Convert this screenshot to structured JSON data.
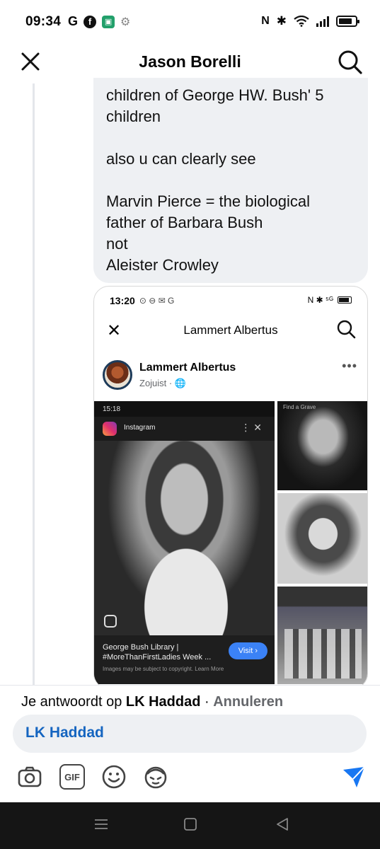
{
  "status_bar": {
    "time": "09:34",
    "g_icon": "G",
    "fb_icon": "f",
    "right_icons": [
      "nfc-icon",
      "bluetooth-icon",
      "wifi-icon",
      "signal-icon",
      "battery-icon"
    ],
    "nfc_label": "N",
    "bt_label": "✱"
  },
  "header": {
    "title": "Jason Borelli"
  },
  "message": {
    "lines": [
      "children of George HW. Bush' 5",
      "children",
      "",
      "also u can clearly see",
      "",
      "Marvin Pierce = the biological",
      "father of Barbara Bush",
      "not",
      "Aleister Crowley"
    ]
  },
  "embedded": {
    "time": "13:20",
    "status_glyphs": "⊙ ⊖ ✉ G",
    "right_glyphs": "N ✱ ⁵ᴳ",
    "title": "Lammert Albertus",
    "post": {
      "author": "Lammert Albertus",
      "meta": "Zojuist · 🌐",
      "dots": "•••"
    },
    "instagram": {
      "inner_time": "15:18",
      "app_name": "Instagram",
      "caption_line1": "George Bush Library |",
      "caption_line2": "#MoreThanFirstLadies Week ...",
      "copyright": "Images may be subject to copyright. Learn More",
      "visit": "Visit ›",
      "controls": "⋮  ✕"
    },
    "findagrave": "Find a Grave"
  },
  "reply": {
    "prefix": "Je antwoordt op ",
    "name": "LK Haddad",
    "separator": " · ",
    "cancel": "Annuleren",
    "input_value": "LK Haddad"
  },
  "toolbar": {
    "icons": [
      "camera-icon",
      "gif-icon",
      "emoji-icon",
      "avatar-sticker-icon",
      "send-icon"
    ],
    "gif_label": "GIF",
    "send_color": "#1877f2"
  }
}
